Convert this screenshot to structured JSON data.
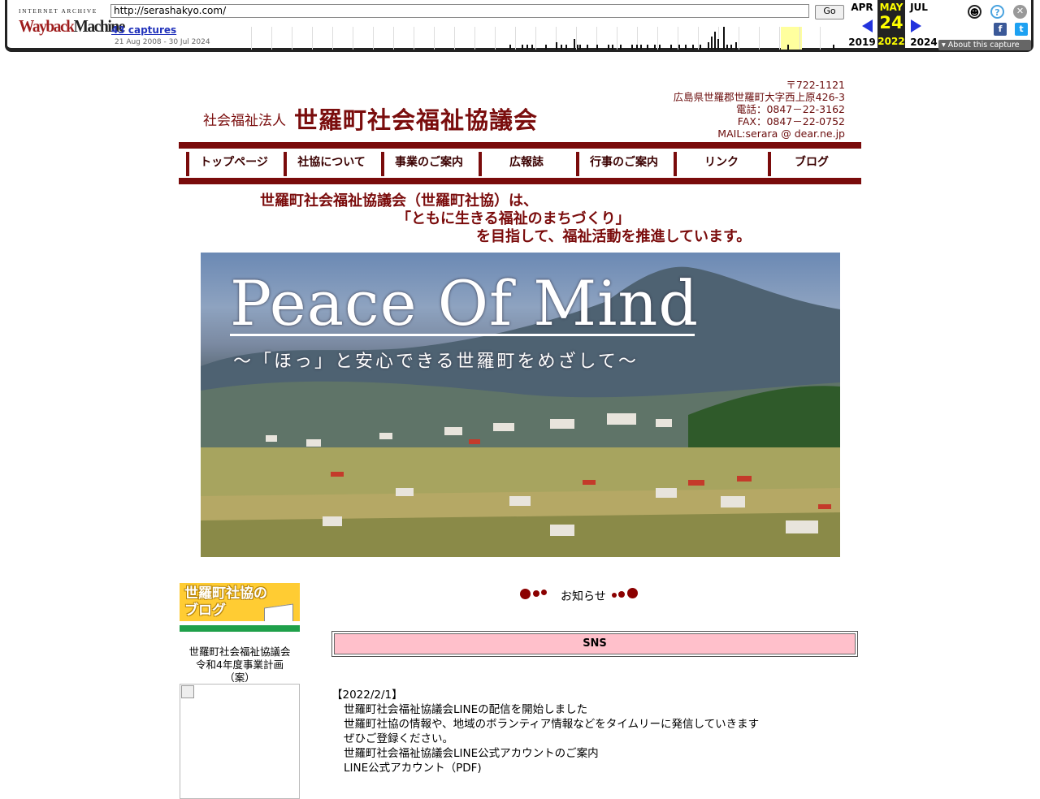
{
  "wayback": {
    "logo_top": "INTERNET ARCHIVE",
    "logo_main_a": "Wayback",
    "logo_main_b": "Machine",
    "url": "http://serashakyo.com/",
    "go_label": "Go",
    "captures": "43 captures",
    "range": "21 Aug 2008 - 30 Jul 2024",
    "prev_month": "APR",
    "prev_year": "2019",
    "cur_month": "MAY",
    "cur_day": "24",
    "cur_year": "2022",
    "next_month": "JUL",
    "next_year": "2024",
    "about": "▾ About this capture",
    "sparkline_capture_counts": [
      1,
      1,
      1,
      1,
      1,
      2,
      1,
      1,
      3,
      1,
      1,
      1,
      1,
      1,
      1,
      1,
      1,
      1,
      1,
      1,
      1,
      1,
      1,
      1,
      1,
      1,
      1,
      2,
      4,
      6,
      3,
      8,
      1,
      1,
      2,
      1,
      1
    ]
  },
  "header": {
    "org_type": "社会福祉法人",
    "org_name": "世羅町社会福祉協議会",
    "contact": [
      "〒722-1121",
      "広島県世羅郡世羅町大字西上原426-3",
      "電話：0847－22-3162",
      "FAX：0847－22-0752",
      "MAIL:serara @ dear.ne.jp"
    ]
  },
  "nav": [
    "トップページ",
    "社協について",
    "事業のご案内",
    "広報誌",
    "行事のご案内",
    "リンク",
    "ブログ"
  ],
  "motto": [
    "世羅町社会福祉協議会（世羅町社協）は、",
    "「ともに生きる福祉のまちづくり」",
    "を目指して、福祉活動を推進しています。"
  ],
  "hero": {
    "title": "Peace Of  Mind",
    "subtitle": "～「ほっ」と安心できる世羅町をめざして～"
  },
  "sidebar": {
    "blog_banner": "世羅町社協の\nブログ",
    "text": [
      "世羅町社会福祉協議会",
      "令和4年度事業計画",
      "（案）"
    ]
  },
  "main": {
    "section_title": "お知らせ",
    "sns_label": "SNS",
    "news": [
      "【2022/2/1】",
      "世羅町社会福祉協議会LINEの配信を開始しました",
      "世羅町社協の情報や、地域のボランティア情報などをタイムリーに発信していきます",
      "ぜひご登録ください。",
      "",
      "世羅町社会福祉協議会LINE公式アカウントのご案内",
      "LINE公式アカウント（PDF)"
    ]
  },
  "colors": {
    "brand": "#7a0b0b",
    "sns_bg": "#ffc0cb",
    "wayback_blue": "#2233dd"
  }
}
